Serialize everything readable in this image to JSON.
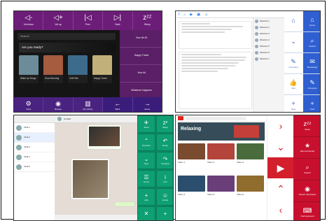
{
  "q1": {
    "top_buttons": [
      {
        "label": "Vol down",
        "icon": "speaker-down-icon",
        "glyph": "◁-"
      },
      {
        "label": "Vol up",
        "icon": "speaker-up-icon",
        "glyph": "◁+"
      },
      {
        "label": "Prev",
        "icon": "previous-icon",
        "glyph": "|◁"
      },
      {
        "label": "Next",
        "icon": "next-icon",
        "glyph": "▷|"
      },
      {
        "label": "Sleep",
        "icon": "sleep-icon",
        "glyph": "zᶻᶻ"
      }
    ],
    "search_placeholder": "Search",
    "hero_text": "Are you ready?",
    "cards": [
      {
        "title": "Wake up Songs",
        "color": "#6c8c9a"
      },
      {
        "title": "Good Morning",
        "color": "#a55c3f"
      },
      {
        "title": "Chill Hits",
        "color": "#3d6b8c"
      },
      {
        "title": "Happy Tunes",
        "color": "#c2b07a"
      }
    ],
    "right_items": [
      "Your hit 40",
      "Stay on the Bugtalk",
      "Happy Tunes",
      "Whistle 20"
    ],
    "right_items_more": [
      "Your hit",
      "Whatever happens"
    ],
    "bottom_buttons": [
      {
        "label": "Tools",
        "icon": "tools-icon",
        "glyph": "⚙"
      },
      {
        "label": "Browse",
        "icon": "spotify-icon",
        "glyph": "◉"
      },
      {
        "label": "My Library",
        "icon": "library-icon",
        "glyph": "▥"
      },
      {
        "label": "Back",
        "icon": "back-arrow-icon",
        "glyph": "←"
      },
      {
        "label": "Home",
        "icon": "forward-arrow-icon",
        "glyph": "→"
      }
    ]
  },
  "q2": {
    "top_items": [
      "f",
      "⌂",
      "▶",
      "▣",
      "☺"
    ],
    "right_col1": [
      {
        "label": "",
        "icon": "home-icon",
        "glyph": "⌂"
      },
      {
        "label": "",
        "icon": "chevron-down-icon",
        "glyph": "⌄"
      },
      {
        "label": "Comment",
        "icon": "comment-icon",
        "glyph": "✎"
      },
      {
        "label": "Like",
        "icon": "like-icon",
        "glyph": "👍"
      },
      {
        "label": "New",
        "icon": "plus-icon",
        "glyph": "+"
      }
    ],
    "right_col2": [
      {
        "label": "Home",
        "icon": "home-icon-2",
        "glyph": "⌂"
      },
      {
        "label": "Search",
        "icon": "search-icon",
        "glyph": "⌕"
      },
      {
        "label": "Messenger",
        "icon": "messenger-icon",
        "glyph": "✉"
      },
      {
        "label": "Compose",
        "icon": "compose-icon",
        "glyph": "✎"
      },
      {
        "label": "Post",
        "icon": "plus-icon-2",
        "glyph": "+"
      }
    ],
    "side_items": [
      "Shortcut 1",
      "Shortcut 2",
      "Shortcut 3",
      "Shortcut 4",
      "Shortcut 5",
      "Shortcut 6",
      "Shortcut 7"
    ]
  },
  "q3": {
    "contacts": [
      {
        "name": "Chat 1"
      },
      {
        "name": "Chat 2"
      },
      {
        "name": "Chat 3"
      },
      {
        "name": "Chat 4"
      },
      {
        "name": "Chat 5"
      }
    ],
    "chat_title": "Contact",
    "grid": [
      {
        "label": "Send",
        "icon": "send-icon",
        "glyph": "✈"
      },
      {
        "label": "Sleep",
        "icon": "sleep-icon",
        "glyph": "zᶻ"
      },
      {
        "label": "Previous",
        "icon": "chevron-up-icon",
        "glyph": "⌃"
      },
      {
        "label": "Reply",
        "icon": "reply-icon",
        "glyph": "↶"
      },
      {
        "label": "Next",
        "icon": "chevron-down-icon",
        "glyph": "⌄"
      },
      {
        "label": "Forward",
        "icon": "forward-icon",
        "glyph": "↷"
      },
      {
        "label": "Home",
        "icon": "chat-icon",
        "glyph": "☰"
      },
      {
        "label": "Info",
        "icon": "info-icon",
        "glyph": "i"
      },
      {
        "label": "Add",
        "icon": "add-icon",
        "glyph": "+"
      },
      {
        "label": "Emoji",
        "icon": "emoji-icon",
        "glyph": "☺"
      },
      {
        "label": "Delete",
        "icon": "delete-icon",
        "glyph": "✕"
      },
      {
        "label": "More",
        "icon": "more-icon",
        "glyph": "+"
      }
    ]
  },
  "q4": {
    "hero_text": "Relaxing",
    "arrows": [
      {
        "glyph": "›",
        "icon": "right-arrow-icon"
      },
      {
        "glyph": "⌄",
        "icon": "down-arrow-icon"
      },
      {
        "glyph": "▶",
        "icon": "play-icon"
      },
      {
        "glyph": "⌃",
        "icon": "up-arrow-icon"
      },
      {
        "glyph": "‹",
        "icon": "left-arrow-icon"
      }
    ],
    "reds": [
      {
        "label": "Sleep",
        "icon": "sleep-icon",
        "glyph": "zᶻᶻ"
      },
      {
        "label": "Recommended",
        "icon": "star-icon",
        "glyph": "★"
      },
      {
        "label": "Search",
        "icon": "search-icon",
        "glyph": "⌕"
      },
      {
        "label": "Search description",
        "icon": "mic-icon",
        "glyph": "◉"
      },
      {
        "label": "Grid keyboard",
        "icon": "keyboard-icon",
        "glyph": "⌨"
      }
    ],
    "thumbs": [
      {
        "color": "#7a4b2e",
        "cap": "Video 1"
      },
      {
        "color": "#b3453d",
        "cap": "Video 2"
      },
      {
        "color": "#4a6c3d",
        "cap": "Video 3"
      },
      {
        "color": "#2c4e6d",
        "cap": "Video 4"
      },
      {
        "color": "#6a3f79",
        "cap": "Video 5"
      },
      {
        "color": "#906c2d",
        "cap": "Video 6"
      }
    ]
  }
}
